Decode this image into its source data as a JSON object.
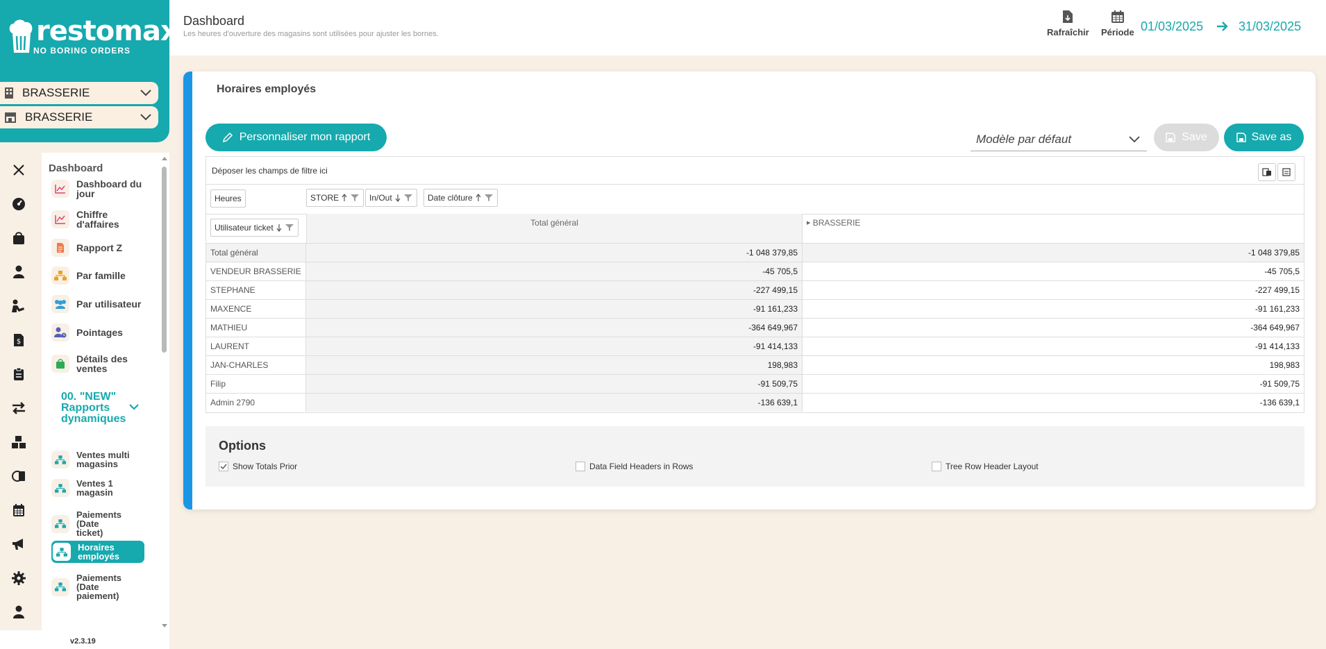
{
  "brand": {
    "name": "restomax",
    "tagline": "NO BORING ORDERS",
    "color": "#16a9ae"
  },
  "stores": [
    {
      "label": "BRASSERIE",
      "icon": "building-icon"
    },
    {
      "label": "BRASSERIE",
      "icon": "shop-icon"
    }
  ],
  "header": {
    "title": "Dashboard",
    "subtitle": "Les heures d'ouverture des magasins sont utilisées pour ajuster les bornes.",
    "refresh_label": "Rafraîchir",
    "period_label": "Période",
    "date_from": "01/03/2025",
    "date_to": "31/03/2025"
  },
  "menu": {
    "section": "Dashboard",
    "items": [
      {
        "label": "Dashboard du jour",
        "icon": "chart-line-icon"
      },
      {
        "label": "Chiffre d'affaires",
        "icon": "chart-line-icon"
      },
      {
        "label": "Rapport Z",
        "icon": "document-icon"
      },
      {
        "label": "Par famille",
        "icon": "hierarchy-icon"
      },
      {
        "label": "Par utilisateur",
        "icon": "users-icon"
      },
      {
        "label": "Pointages",
        "icon": "user-clock-icon"
      },
      {
        "label": "Détails des ventes",
        "icon": "shopping-bag-icon"
      }
    ],
    "group": "00. \"NEW\" Rapports dynamiques",
    "subitems": [
      {
        "label": "Ventes multi magasins"
      },
      {
        "label": "Ventes 1 magasin"
      },
      {
        "label": "Paiements (Date ticket)"
      },
      {
        "label": "Horaires employés",
        "active": true
      },
      {
        "label": "Paiements (Date paiement)"
      }
    ]
  },
  "version": "v2.3.19",
  "report": {
    "title": "Horaires employés",
    "customize_label": "Personnaliser mon rapport",
    "model_label": "Modèle par défaut",
    "save_label": "Save",
    "save_as_label": "Save as"
  },
  "pivot": {
    "filter_placeholder": "Déposer les champs de filtre ici",
    "data_field": "Heures",
    "column_fields": [
      "STORE",
      "In/Out",
      "Date clôture"
    ],
    "row_field": "Utilisateur ticket",
    "col_headers": [
      "Total général",
      "BRASSERIE"
    ],
    "rows": [
      {
        "name": "Total général",
        "total": "-1 048 379,85",
        "brasserie": "-1 048 379,85"
      },
      {
        "name": "VENDEUR BRASSERIE",
        "total": "-45 705,5",
        "brasserie": "-45 705,5"
      },
      {
        "name": "STEPHANE",
        "total": "-227 499,15",
        "brasserie": "-227 499,15"
      },
      {
        "name": "MAXENCE",
        "total": "-91 161,233",
        "brasserie": "-91 161,233"
      },
      {
        "name": "MATHIEU",
        "total": "-364 649,967",
        "brasserie": "-364 649,967"
      },
      {
        "name": "LAURENT",
        "total": "-91 414,133",
        "brasserie": "-91 414,133"
      },
      {
        "name": "JAN-CHARLES",
        "total": "198,983",
        "brasserie": "198,983"
      },
      {
        "name": "Filip",
        "total": "-91 509,75",
        "brasserie": "-91 509,75"
      },
      {
        "name": "Admin 2790",
        "total": "-136 639,1",
        "brasserie": "-136 639,1"
      }
    ]
  },
  "options": {
    "title": "Options",
    "items": [
      {
        "label": "Show Totals Prior",
        "checked": true
      },
      {
        "label": "Data Field Headers in Rows",
        "checked": false
      },
      {
        "label": "Tree Row Header Layout",
        "checked": false
      }
    ]
  }
}
